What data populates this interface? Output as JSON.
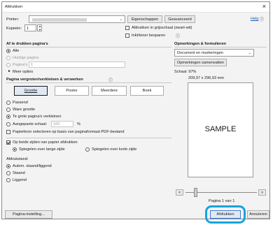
{
  "window": {
    "title": "Afdrukken"
  },
  "printer": {
    "label": "Printer:",
    "value": "",
    "properties_button": "Eigenschappen",
    "advanced_button": "Geavanceerd",
    "help_link": "Help"
  },
  "copies": {
    "label": "Kopieën:",
    "value": "1"
  },
  "options": {
    "grayscale": "Afdrukken in grijsschaal (zwart-wit)",
    "save_ink": "Inkt/toner besparen"
  },
  "pages": {
    "heading": "Af te drukken pagina's",
    "all": "Alle",
    "current": "Huidige pagina",
    "pages_label": "Pagina's",
    "pages_value": "1",
    "more": "Meer opties"
  },
  "sizing": {
    "heading": "Pagina vergroten/verkleinen & verwerken",
    "tabs": [
      "Grootte",
      "Poster",
      "Meerdere",
      "Boek"
    ],
    "fit": "Passend",
    "actual": "Ware grootte",
    "shrink": "Te grote pagina's verkleinen",
    "custom": "Aangepaste schaal:",
    "custom_value": "100",
    "custom_unit": "%",
    "paper_source": "Papierbron selecteren op basis van paginaformaat PDF-bestand"
  },
  "duplex": {
    "label": "Op beide zijden van papier afdrukken",
    "long": "Spiegelen over lange zijde",
    "short": "Spiegelen over korte zijde"
  },
  "orientation": {
    "heading": "Afdrukstand:",
    "auto": "Autom. staand/liggend",
    "portrait": "Staand",
    "landscape": "Liggend"
  },
  "comments": {
    "heading": "Opmerkingen & formulieren",
    "select_value": "Document en markeringen",
    "summarize_button": "Opmerkingen samenvatten",
    "scale": "Schaal: 97%",
    "dims": "209,97 x 296,93 mm",
    "preview_text": "SAMPLE",
    "page_counter": "Pagina 1 van 1"
  },
  "footer": {
    "page_setup": "Pagina-instelling...",
    "print": "Afdrukken",
    "cancel": "Annuleren"
  },
  "colors": {
    "highlight": "#1aa3d9",
    "link": "#1a5fb4"
  }
}
